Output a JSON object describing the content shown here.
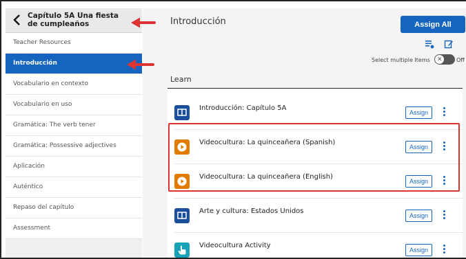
{
  "sidebar": {
    "back_icon": "chevron-left-icon",
    "title": "Capítulo 5A Una fiesta de cumpleaños",
    "items": [
      {
        "label": "Teacher Resources",
        "active": false
      },
      {
        "label": "Introducción",
        "active": true
      },
      {
        "label": "Vocabulario en contexto",
        "active": false
      },
      {
        "label": "Vocabulario en uso",
        "active": false
      },
      {
        "label": "Gramática: The verb tener",
        "active": false
      },
      {
        "label": "Gramática: Possessive adjectives",
        "active": false
      },
      {
        "label": "Aplicación",
        "active": false
      },
      {
        "label": "Auténtico",
        "active": false
      },
      {
        "label": "Repaso del capítulo",
        "active": false
      },
      {
        "label": "Assessment",
        "active": false
      }
    ]
  },
  "main": {
    "title": "Introducción",
    "assign_all_label": "Assign All",
    "select_multiple_label": "Select multiple Items",
    "toggle_state": "off",
    "toggle_off_label": "Off",
    "section_label": "Learn",
    "rows": [
      {
        "label": "Introducción: Capítulo 5A",
        "icon": "book-icon",
        "icon_color": "#1b4f9b",
        "assign_label": "Assign"
      },
      {
        "label": "Videocultura: La quinceañera (Spanish)",
        "icon": "play-icon",
        "icon_color": "#e07b00",
        "assign_label": "Assign"
      },
      {
        "label": "Videocultura: La quinceañera (English)",
        "icon": "play-icon",
        "icon_color": "#e07b00",
        "assign_label": "Assign"
      },
      {
        "label": "Arte y cultura: Estados Unidos",
        "icon": "book-icon",
        "icon_color": "#1b4f9b",
        "assign_label": "Assign"
      },
      {
        "label": "Videocultura Activity",
        "icon": "hand-pointer-icon",
        "icon_color": "#17a2b8",
        "assign_label": "Assign"
      }
    ]
  },
  "colors": {
    "primary": "#1565c0",
    "highlight": "#d33333"
  }
}
